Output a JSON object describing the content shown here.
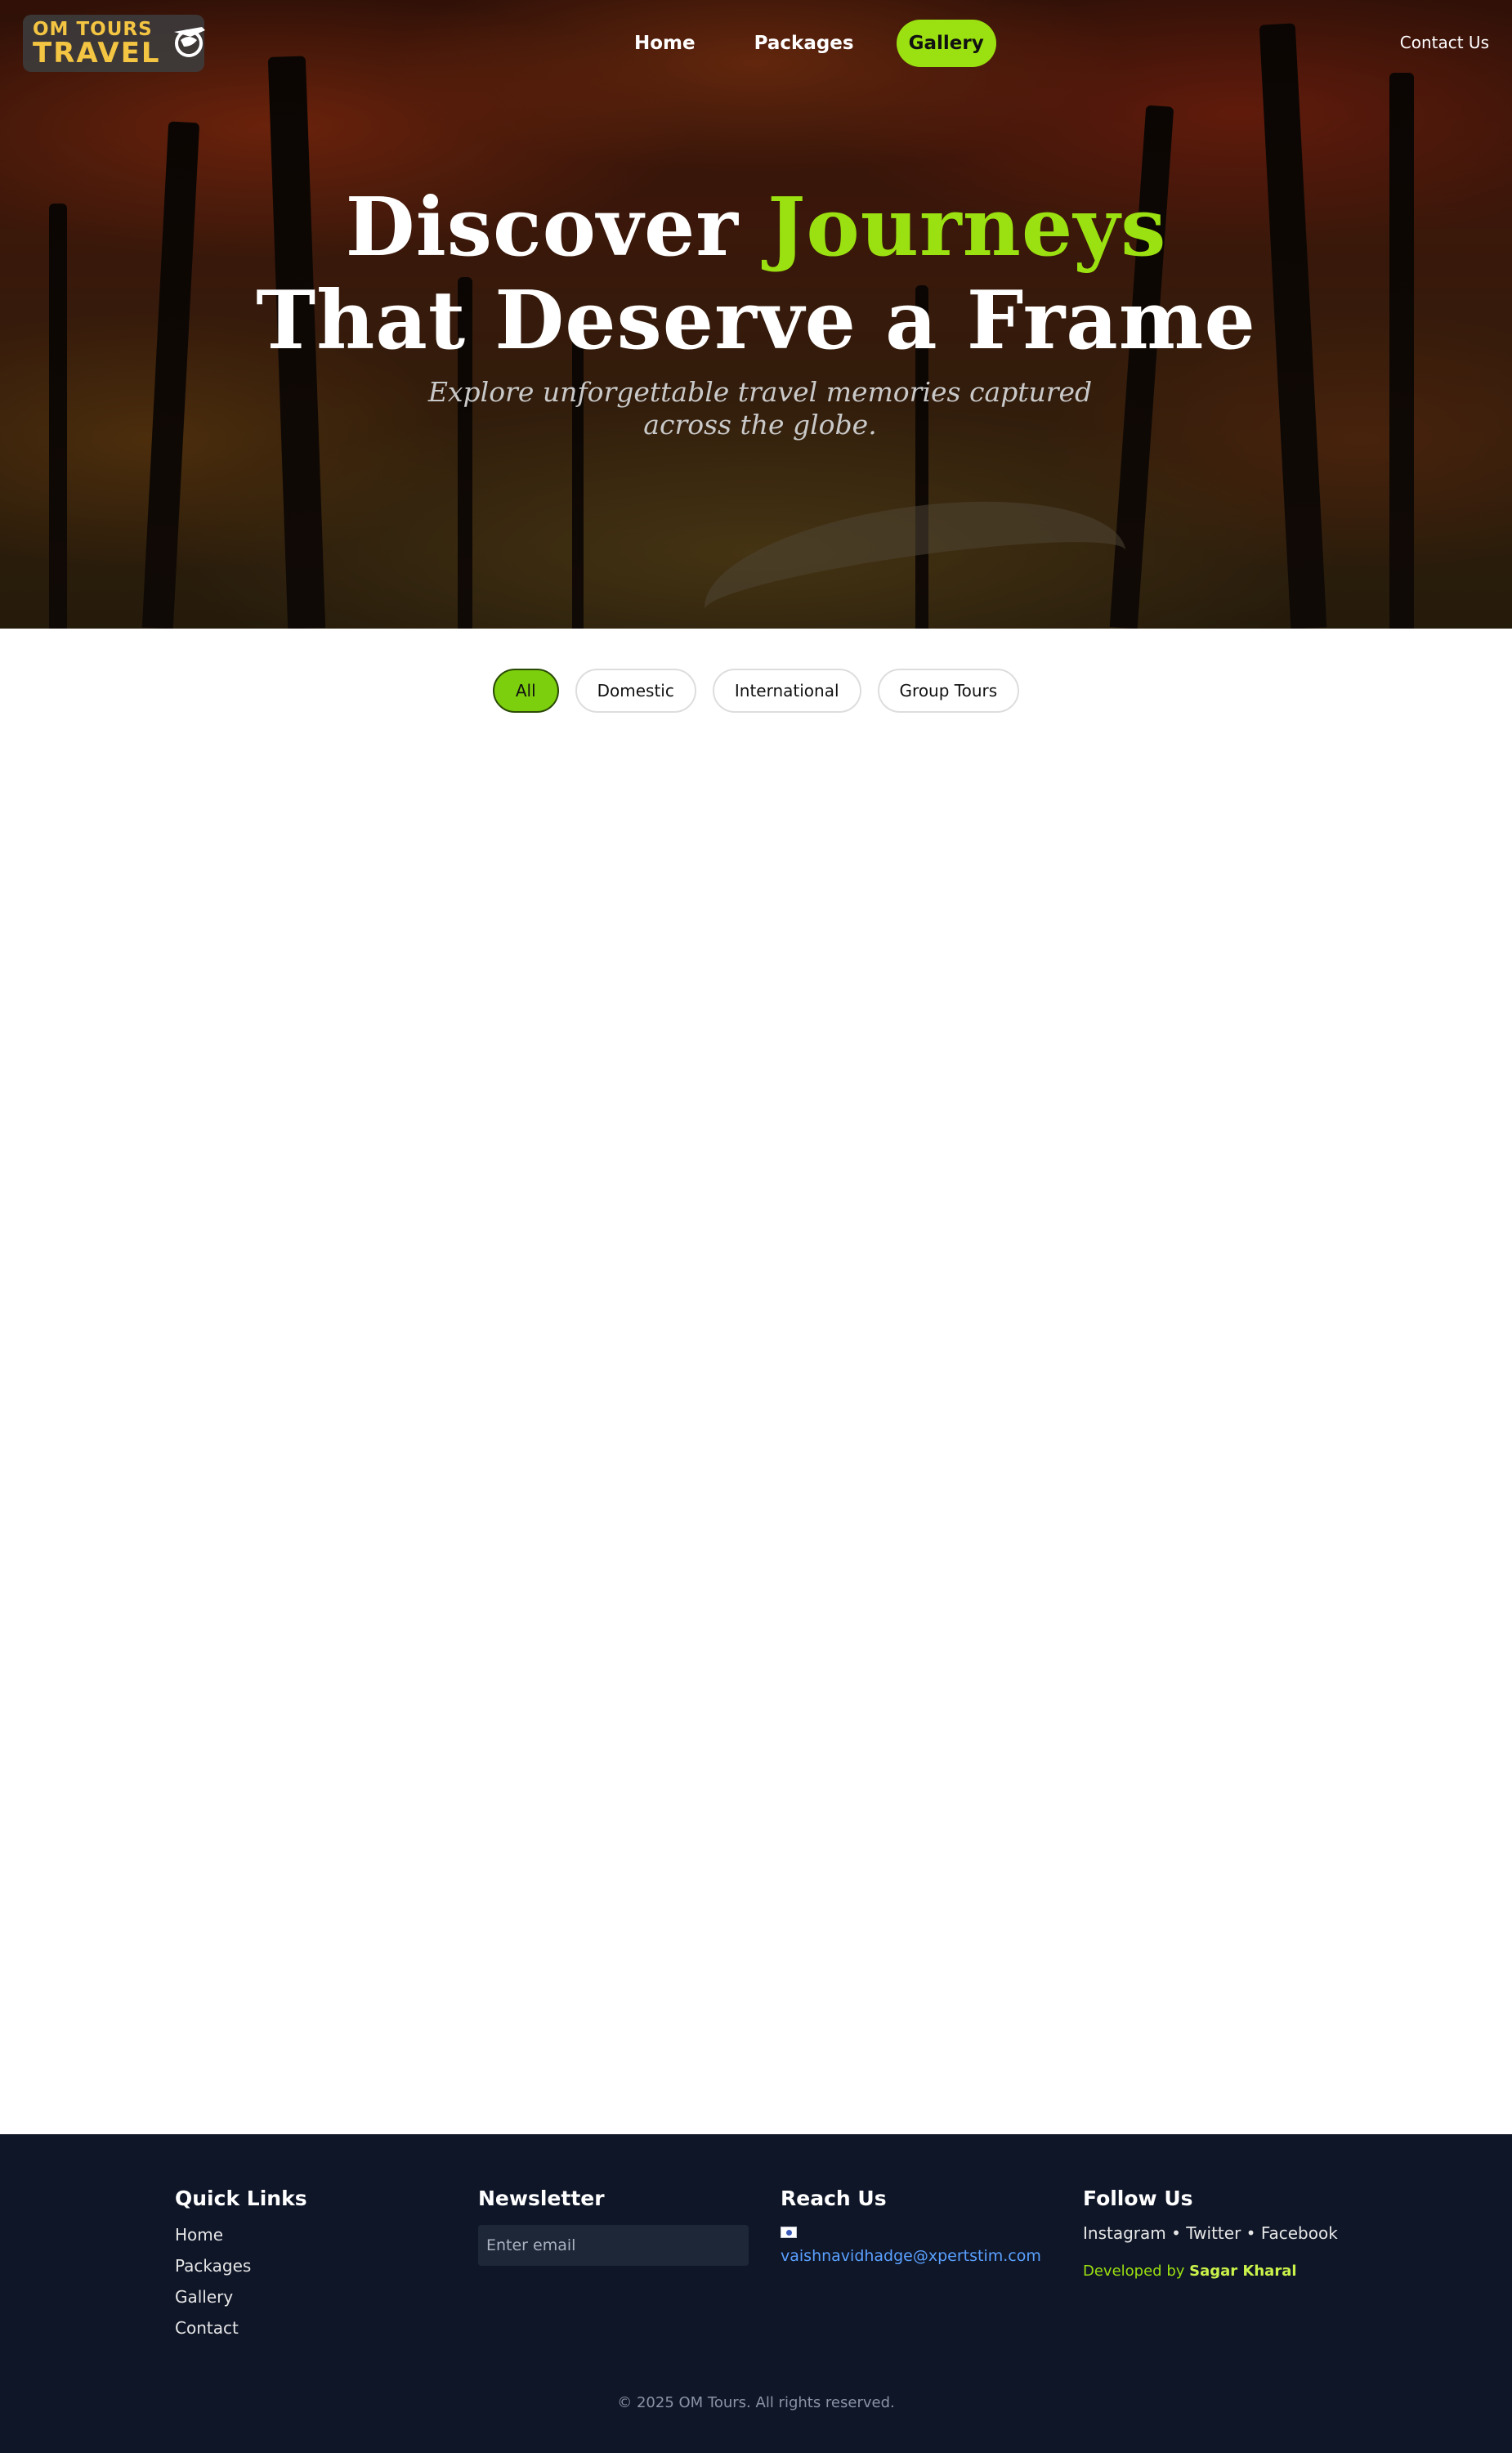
{
  "brand": {
    "logo_line1": "OM TOURS",
    "logo_line2": "TRAVEL",
    "accent_color": "#9be010",
    "logo_color": "#f4c542"
  },
  "nav": {
    "items": [
      {
        "label": "Home",
        "active": false
      },
      {
        "label": "Packages",
        "active": false
      },
      {
        "label": "Gallery",
        "active": true
      }
    ],
    "contact_label": "Contact Us"
  },
  "hero": {
    "title_part1": "Discover ",
    "title_accent": "Journeys",
    "title_line2": "That Deserve a Frame",
    "subtitle": "Explore unforgettable travel memories captured across the globe."
  },
  "filters": {
    "items": [
      {
        "label": "All",
        "active": true
      },
      {
        "label": "Domestic",
        "active": false
      },
      {
        "label": "International",
        "active": false
      },
      {
        "label": "Group Tours",
        "active": false
      }
    ],
    "active_color": "#7ccf0d"
  },
  "footer": {
    "quick_links": {
      "title": "Quick Links",
      "items": [
        "Home",
        "Packages",
        "Gallery",
        "Contact"
      ]
    },
    "newsletter": {
      "title": "Newsletter",
      "placeholder": "Enter email"
    },
    "reach_us": {
      "title": "Reach Us",
      "flag_icon": "flag-icon",
      "email": "vaishnavidhadge@xpertstim.com"
    },
    "follow_us": {
      "title": "Follow Us",
      "socials": [
        "Instagram",
        "Twitter",
        "Facebook"
      ],
      "separator": " • ",
      "developed_by_prefix": "Developed by ",
      "developer_name": "Sagar Kharal"
    },
    "copyright": "© 2025 OM Tours. All rights reserved.",
    "background_color": "#0f1628"
  }
}
